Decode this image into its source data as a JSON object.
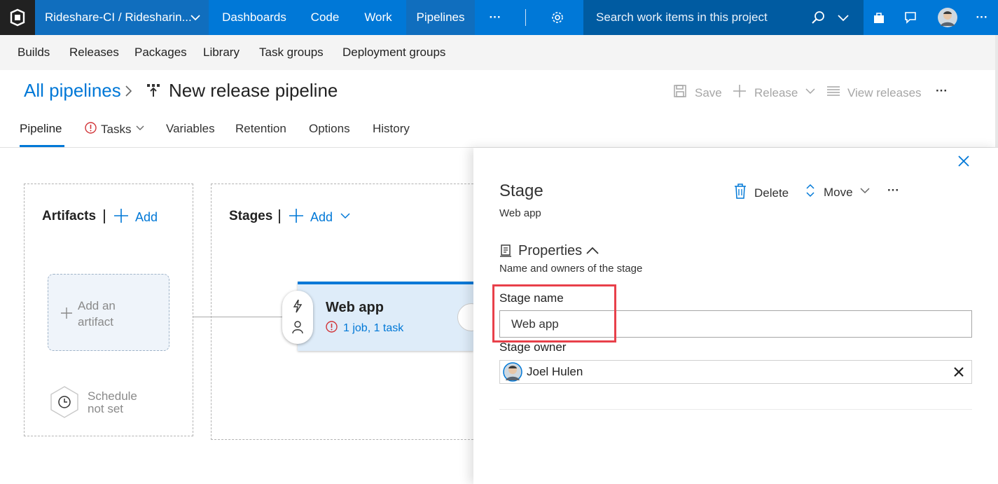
{
  "topbar": {
    "project": "Rideshare-CI / Ridesharin...",
    "nav": [
      "Dashboards",
      "Code",
      "Work",
      "Pipelines"
    ],
    "active_nav": "Pipelines",
    "more": "···",
    "search_placeholder": "Search work items in this project"
  },
  "subnav": {
    "items": [
      "Builds",
      "Releases",
      "Packages",
      "Library",
      "Task groups",
      "Deployment groups"
    ]
  },
  "header": {
    "breadcrumb_root": "All pipelines",
    "title": "New release pipeline",
    "commands": {
      "save": "Save",
      "release": "Release",
      "view_releases": "View releases",
      "more": "···"
    }
  },
  "tabs": [
    "Pipeline",
    "Tasks",
    "Variables",
    "Retention",
    "Options",
    "History"
  ],
  "active_tab": "Pipeline",
  "artifacts": {
    "title": "Artifacts",
    "add_label": "Add",
    "placeholder_line1": "Add an",
    "placeholder_line2": "artifact",
    "schedule_line1": "Schedule",
    "schedule_line2": "not set"
  },
  "stages": {
    "title": "Stages",
    "add_label": "Add",
    "stage_name": "Web app",
    "stage_summary": "1 job, 1 task"
  },
  "panel": {
    "title": "Stage",
    "subtitle": "Web app",
    "delete_label": "Delete",
    "move_label": "Move",
    "more": "···",
    "section_title": "Properties",
    "section_sub": "Name and owners of the stage",
    "stage_name_label": "Stage name",
    "stage_name_value": "Web app",
    "stage_owner_label": "Stage owner",
    "stage_owner_value": "Joel Hulen"
  },
  "colors": {
    "brand": "#0078d7",
    "topbar": "#0078d7",
    "highlight": "#e8404a",
    "warning": "#d13438"
  }
}
